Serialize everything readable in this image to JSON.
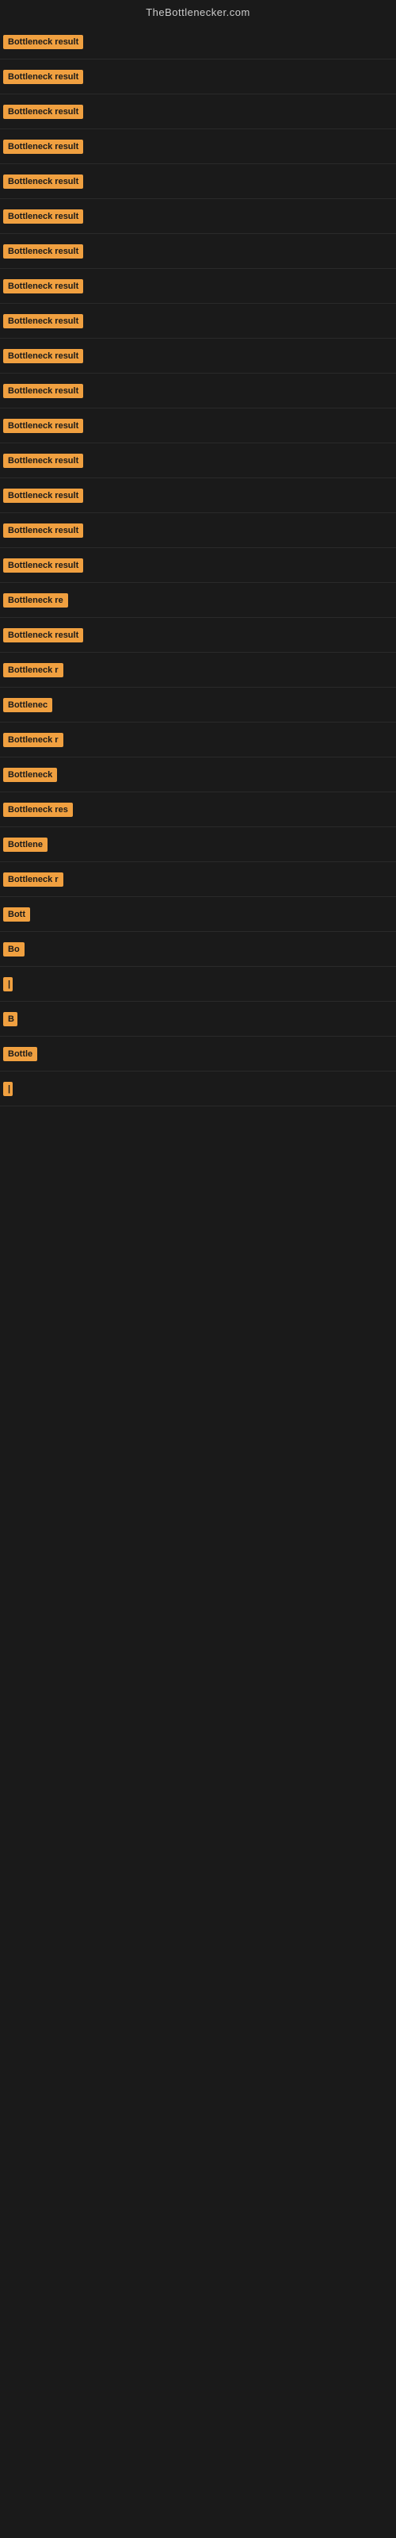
{
  "site": {
    "title": "TheBottlenecker.com"
  },
  "rows": [
    {
      "id": 1,
      "label": "Bottleneck result",
      "width": 140
    },
    {
      "id": 2,
      "label": "Bottleneck result",
      "width": 140
    },
    {
      "id": 3,
      "label": "Bottleneck result",
      "width": 140
    },
    {
      "id": 4,
      "label": "Bottleneck result",
      "width": 140
    },
    {
      "id": 5,
      "label": "Bottleneck result",
      "width": 140
    },
    {
      "id": 6,
      "label": "Bottleneck result",
      "width": 140
    },
    {
      "id": 7,
      "label": "Bottleneck result",
      "width": 140
    },
    {
      "id": 8,
      "label": "Bottleneck result",
      "width": 140
    },
    {
      "id": 9,
      "label": "Bottleneck result",
      "width": 140
    },
    {
      "id": 10,
      "label": "Bottleneck result",
      "width": 140
    },
    {
      "id": 11,
      "label": "Bottleneck result",
      "width": 140
    },
    {
      "id": 12,
      "label": "Bottleneck result",
      "width": 140
    },
    {
      "id": 13,
      "label": "Bottleneck result",
      "width": 140
    },
    {
      "id": 14,
      "label": "Bottleneck result",
      "width": 140
    },
    {
      "id": 15,
      "label": "Bottleneck result",
      "width": 140
    },
    {
      "id": 16,
      "label": "Bottleneck result",
      "width": 140
    },
    {
      "id": 17,
      "label": "Bottleneck re",
      "width": 120
    },
    {
      "id": 18,
      "label": "Bottleneck result",
      "width": 130
    },
    {
      "id": 19,
      "label": "Bottleneck r",
      "width": 110
    },
    {
      "id": 20,
      "label": "Bottlenec",
      "width": 90
    },
    {
      "id": 21,
      "label": "Bottleneck r",
      "width": 105
    },
    {
      "id": 22,
      "label": "Bottleneck",
      "width": 95
    },
    {
      "id": 23,
      "label": "Bottleneck res",
      "width": 115
    },
    {
      "id": 24,
      "label": "Bottlene",
      "width": 80
    },
    {
      "id": 25,
      "label": "Bottleneck r",
      "width": 105
    },
    {
      "id": 26,
      "label": "Bott",
      "width": 50
    },
    {
      "id": 27,
      "label": "Bo",
      "width": 28
    },
    {
      "id": 28,
      "label": "|",
      "width": 10
    },
    {
      "id": 29,
      "label": "B",
      "width": 18
    },
    {
      "id": 30,
      "label": "Bottle",
      "width": 55
    },
    {
      "id": 31,
      "label": "|",
      "width": 8
    }
  ],
  "colors": {
    "badge_bg": "#f0a040",
    "badge_text": "#1a1a1a",
    "body_bg": "#1a1a1a",
    "header_text": "#cccccc"
  }
}
